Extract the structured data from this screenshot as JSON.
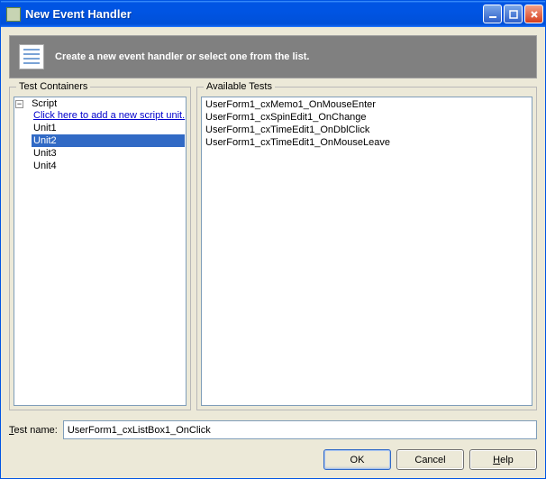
{
  "window": {
    "title": "New Event Handler"
  },
  "banner": {
    "text": "Create a new event handler or select one from the list."
  },
  "left_panel": {
    "legend": "Test Containers",
    "root_label": "Script",
    "add_link": "Click here to add a new script unit.",
    "items": [
      {
        "label": "Unit1",
        "selected": false
      },
      {
        "label": "Unit2",
        "selected": true
      },
      {
        "label": "Unit3",
        "selected": false
      },
      {
        "label": "Unit4",
        "selected": false
      }
    ]
  },
  "right_panel": {
    "legend": "Available Tests",
    "items": [
      "UserForm1_cxMemo1_OnMouseEnter",
      "UserForm1_cxSpinEdit1_OnChange",
      "UserForm1_cxTimeEdit1_OnDblClick",
      "UserForm1_cxTimeEdit1_OnMouseLeave"
    ]
  },
  "test_name": {
    "label": "Test name:",
    "accesskey_index": 0,
    "value": "UserForm1_cxListBox1_OnClick"
  },
  "buttons": {
    "ok": "OK",
    "cancel": "Cancel",
    "help_pre": "",
    "help_u": "H",
    "help_post": "elp"
  },
  "test_name_label_pre": "",
  "test_name_label_u": "T",
  "test_name_label_post": "est name:"
}
